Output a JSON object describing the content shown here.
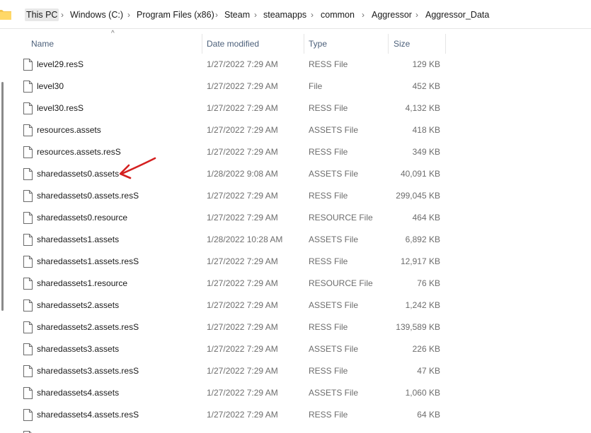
{
  "breadcrumb": {
    "items": [
      "This PC",
      "Windows (C:)",
      "Program Files (x86)",
      "Steam",
      "steamapps",
      "common",
      "Aggressor",
      "Aggressor_Data"
    ],
    "separator": "›"
  },
  "columns": {
    "name": "Name",
    "date": "Date modified",
    "type": "Type",
    "size": "Size"
  },
  "sort_indicator": "^",
  "files": [
    {
      "name": "level29.resS",
      "date": "1/27/2022 7:29 AM",
      "type": "RESS File",
      "size": "129 KB"
    },
    {
      "name": "level30",
      "date": "1/27/2022 7:29 AM",
      "type": "File",
      "size": "452 KB"
    },
    {
      "name": "level30.resS",
      "date": "1/27/2022 7:29 AM",
      "type": "RESS File",
      "size": "4,132 KB"
    },
    {
      "name": "resources.assets",
      "date": "1/27/2022 7:29 AM",
      "type": "ASSETS File",
      "size": "418 KB"
    },
    {
      "name": "resources.assets.resS",
      "date": "1/27/2022 7:29 AM",
      "type": "RESS File",
      "size": "349 KB"
    },
    {
      "name": "sharedassets0.assets",
      "date": "1/28/2022 9:08 AM",
      "type": "ASSETS File",
      "size": "40,091 KB"
    },
    {
      "name": "sharedassets0.assets.resS",
      "date": "1/27/2022 7:29 AM",
      "type": "RESS File",
      "size": "299,045 KB"
    },
    {
      "name": "sharedassets0.resource",
      "date": "1/27/2022 7:29 AM",
      "type": "RESOURCE File",
      "size": "464 KB"
    },
    {
      "name": "sharedassets1.assets",
      "date": "1/28/2022 10:28 AM",
      "type": "ASSETS File",
      "size": "6,892 KB"
    },
    {
      "name": "sharedassets1.assets.resS",
      "date": "1/27/2022 7:29 AM",
      "type": "RESS File",
      "size": "12,917 KB"
    },
    {
      "name": "sharedassets1.resource",
      "date": "1/27/2022 7:29 AM",
      "type": "RESOURCE File",
      "size": "76 KB"
    },
    {
      "name": "sharedassets2.assets",
      "date": "1/27/2022 7:29 AM",
      "type": "ASSETS File",
      "size": "1,242 KB"
    },
    {
      "name": "sharedassets2.assets.resS",
      "date": "1/27/2022 7:29 AM",
      "type": "RESS File",
      "size": "139,589 KB"
    },
    {
      "name": "sharedassets3.assets",
      "date": "1/27/2022 7:29 AM",
      "type": "ASSETS File",
      "size": "226 KB"
    },
    {
      "name": "sharedassets3.assets.resS",
      "date": "1/27/2022 7:29 AM",
      "type": "RESS File",
      "size": "47 KB"
    },
    {
      "name": "sharedassets4.assets",
      "date": "1/27/2022 7:29 AM",
      "type": "ASSETS File",
      "size": "1,060 KB"
    },
    {
      "name": "sharedassets4.assets.resS",
      "date": "1/27/2022 7:29 AM",
      "type": "RESS File",
      "size": "64 KB"
    },
    {
      "name": "",
      "date": "",
      "type": "",
      "size": ""
    }
  ],
  "annotation": {
    "icon": "red-arrow-icon",
    "color": "#d42020"
  },
  "icons": {
    "folder": "folder-icon",
    "file": "file-icon"
  }
}
